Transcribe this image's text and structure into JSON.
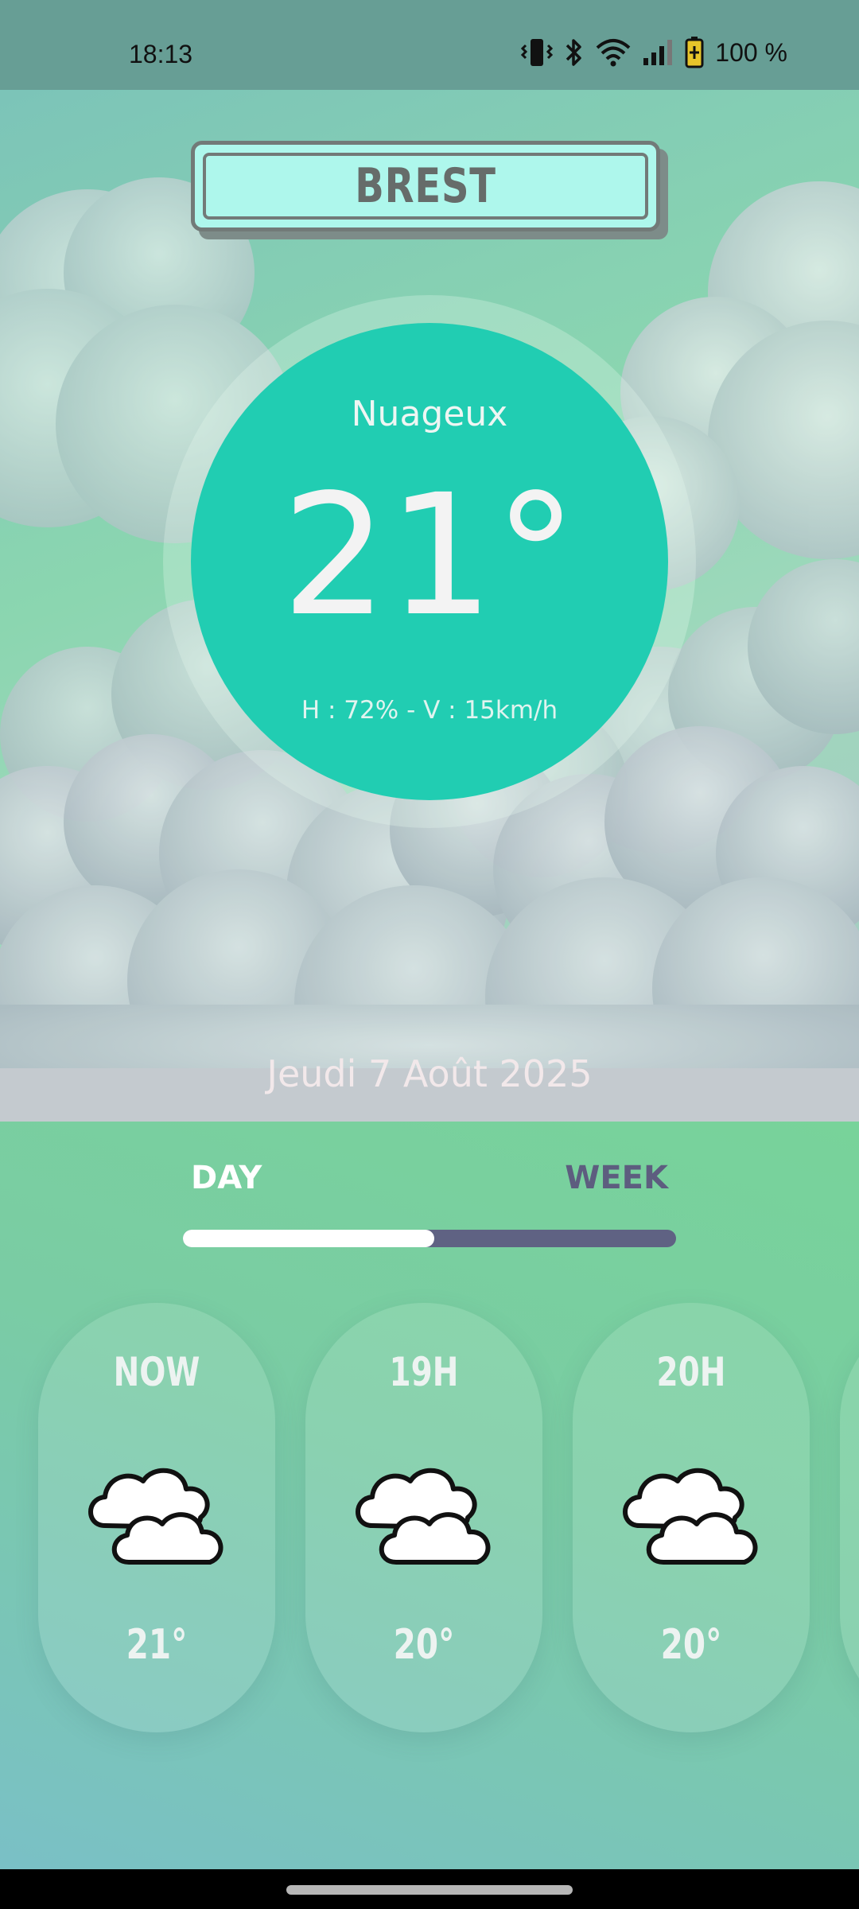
{
  "status_bar": {
    "time": "18:13",
    "battery": "100 %",
    "icons": [
      "vibrate-icon",
      "bluetooth-icon",
      "wifi-icon",
      "signal-icon",
      "battery-icon"
    ]
  },
  "current": {
    "city": "BREST",
    "condition": "Nuageux",
    "temperature": "21°",
    "details": "H : 72% - V : 15km/h",
    "date": "Jeudi 7 Août 2025"
  },
  "tabs": {
    "day_label": "DAY",
    "week_label": "WEEK",
    "selected": "DAY",
    "indicator_fraction": 0.51
  },
  "hourly": [
    {
      "label": "NOW",
      "icon": "cloud-icon",
      "temp": "21°"
    },
    {
      "label": "19H",
      "icon": "cloud-icon",
      "temp": "20°"
    },
    {
      "label": "20H",
      "icon": "cloud-icon",
      "temp": "20°"
    }
  ],
  "colors": {
    "circle": "#21cdb2",
    "city_plate": "#aef7ec",
    "tab_active": "#ffffff",
    "tab_inactive": "#5d5d7f"
  }
}
